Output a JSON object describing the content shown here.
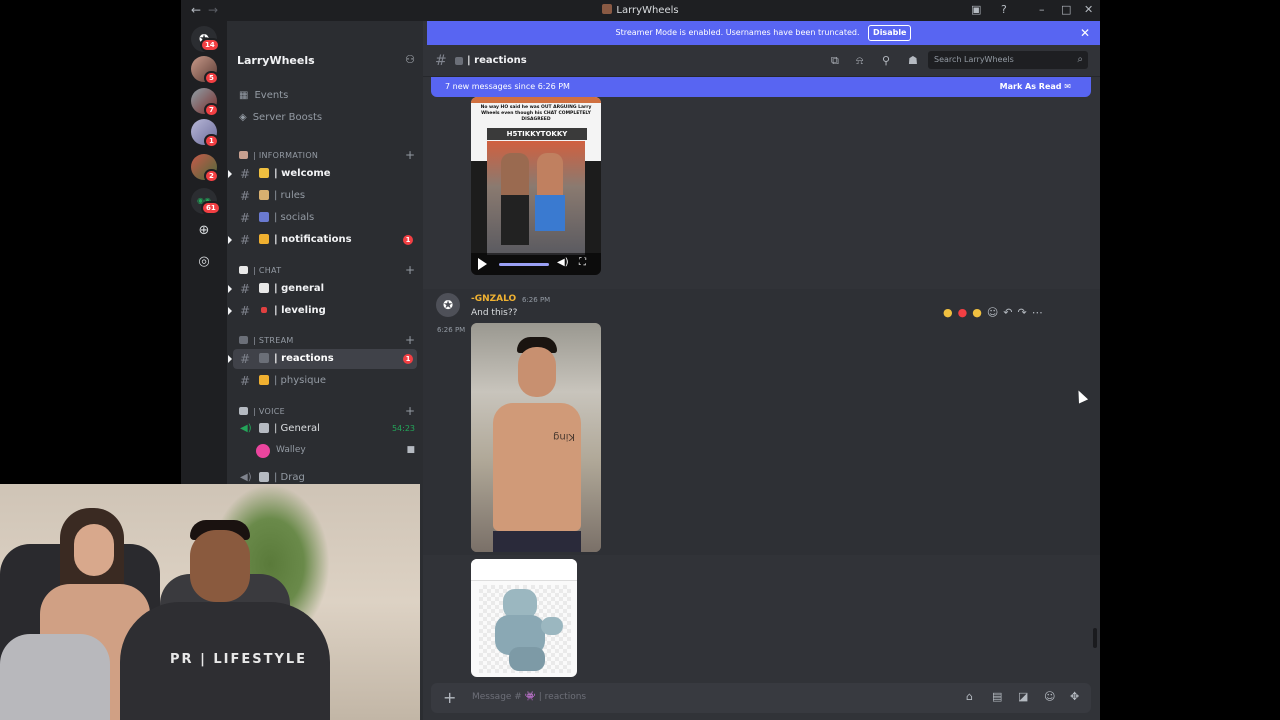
{
  "window": {
    "title": "LarryWheels"
  },
  "guilds": [
    {
      "badge": "14"
    },
    {
      "badge": "5"
    },
    {
      "badge": "7"
    },
    {
      "badge": "1"
    },
    {
      "badge": "2"
    },
    {
      "badge": "61"
    }
  ],
  "streamer_banner": {
    "text": "Streamer Mode is enabled. Usernames have been truncated.",
    "button": "Disable"
  },
  "server": {
    "name": "LarryWheels"
  },
  "sidebar": {
    "events": "Events",
    "boosts": "Server Boosts",
    "categories": {
      "information": "| INFORMATION",
      "chat": "| CHAT",
      "stream": "| STREAM",
      "voice": "| VOICE"
    },
    "channels": {
      "welcome": "| welcome",
      "rules": "| rules",
      "socials": "| socials",
      "notifications": "| notifications",
      "notifications_badge": "1",
      "general": "| general",
      "leveling": "| leveling",
      "reactions": "| reactions",
      "reactions_badge": "1",
      "physique": "| physique",
      "voice_general": "| General",
      "voice_general_time": "54:23",
      "voice_user": "Walley",
      "voice_drag": "| Drag"
    }
  },
  "channel_header": {
    "name": "| reactions",
    "search_placeholder": "Search LarryWheels"
  },
  "new_messages_bar": {
    "text": "7 new messages since 6:26 PM",
    "action": "Mark As Read"
  },
  "messages": {
    "m1_image": {
      "caption_top": "No way HO said he was OUT ARGUING Larry Wheels even though his CHAT COMPLETELY DISAGREED",
      "caption_tag": "H5TIKKYTOKKY"
    },
    "m2": {
      "author": "-GNZALO",
      "time": "6:26 PM",
      "side_time": "6:26 PM",
      "text": "And this??",
      "tattoo": "King"
    }
  },
  "composer": {
    "placeholder": "Message # 👾 | reactions"
  },
  "colors": {
    "accent": "#5865f2",
    "badge": "#f23f43",
    "author": "#f0b232",
    "voice_active": "#23a559"
  }
}
